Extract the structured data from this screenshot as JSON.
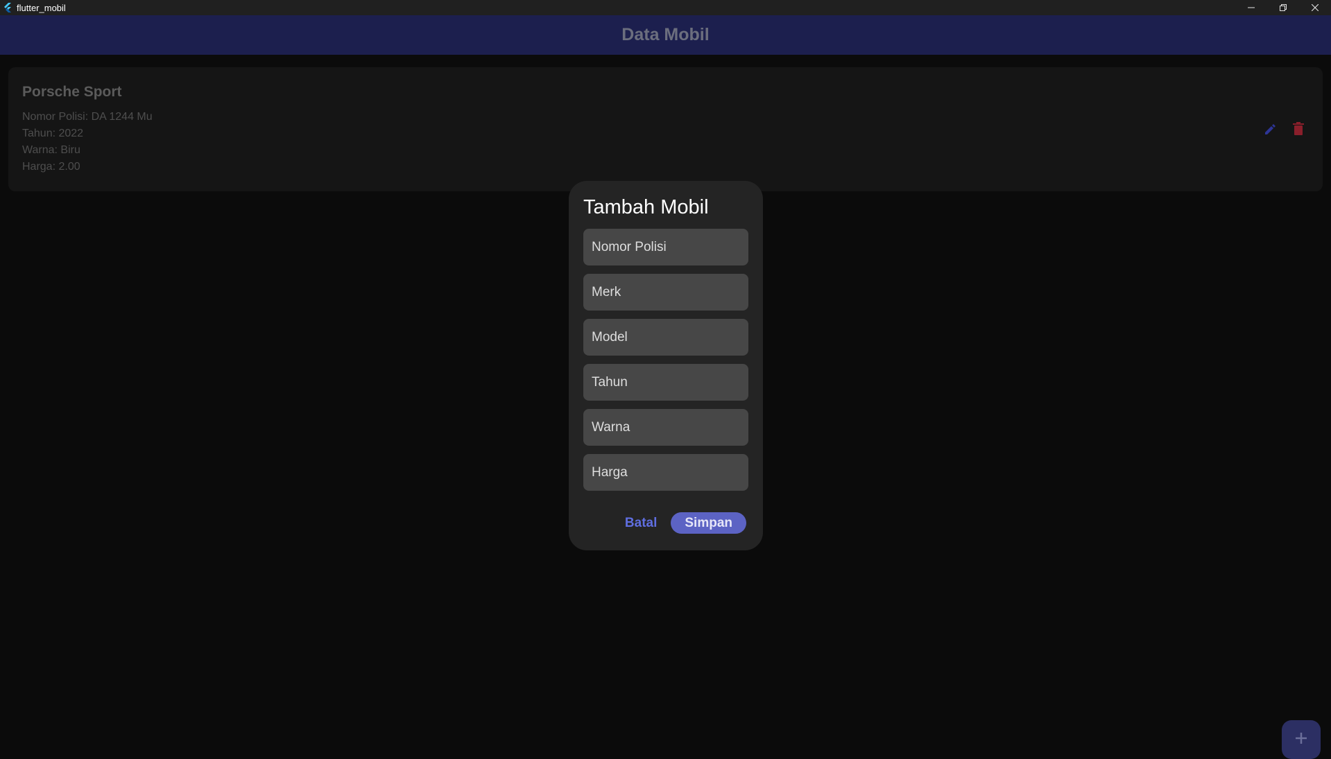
{
  "window": {
    "title": "flutter_mobil",
    "icon": "flutter-logo-icon",
    "controls": [
      "minimize-icon",
      "restore-icon",
      "close-icon"
    ]
  },
  "appbar": {
    "title": "Data Mobil",
    "background": "#1c1f4e"
  },
  "cars": [
    {
      "name": "Porsche Sport",
      "nomor_polisi": "Nomor Polisi: DA 1244 Mu",
      "tahun": "Tahun: 2022",
      "warna": "Warna: Biru",
      "harga": "Harga: 2.00",
      "actions": [
        "edit-icon",
        "delete-icon"
      ]
    }
  ],
  "fab": {
    "icon": "plus-icon"
  },
  "dialog": {
    "title": "Tambah Mobil",
    "fields": [
      {
        "placeholder": "Nomor Polisi",
        "value": ""
      },
      {
        "placeholder": "Merk",
        "value": ""
      },
      {
        "placeholder": "Model",
        "value": ""
      },
      {
        "placeholder": "Tahun",
        "value": ""
      },
      {
        "placeholder": "Warna",
        "value": ""
      },
      {
        "placeholder": "Harga",
        "value": ""
      }
    ],
    "cancel_label": "Batal",
    "save_label": "Simpan"
  },
  "colors": {
    "accent": "#5c63c4",
    "edit_icon": "#2d3596",
    "delete_icon": "#8a1f2b"
  }
}
